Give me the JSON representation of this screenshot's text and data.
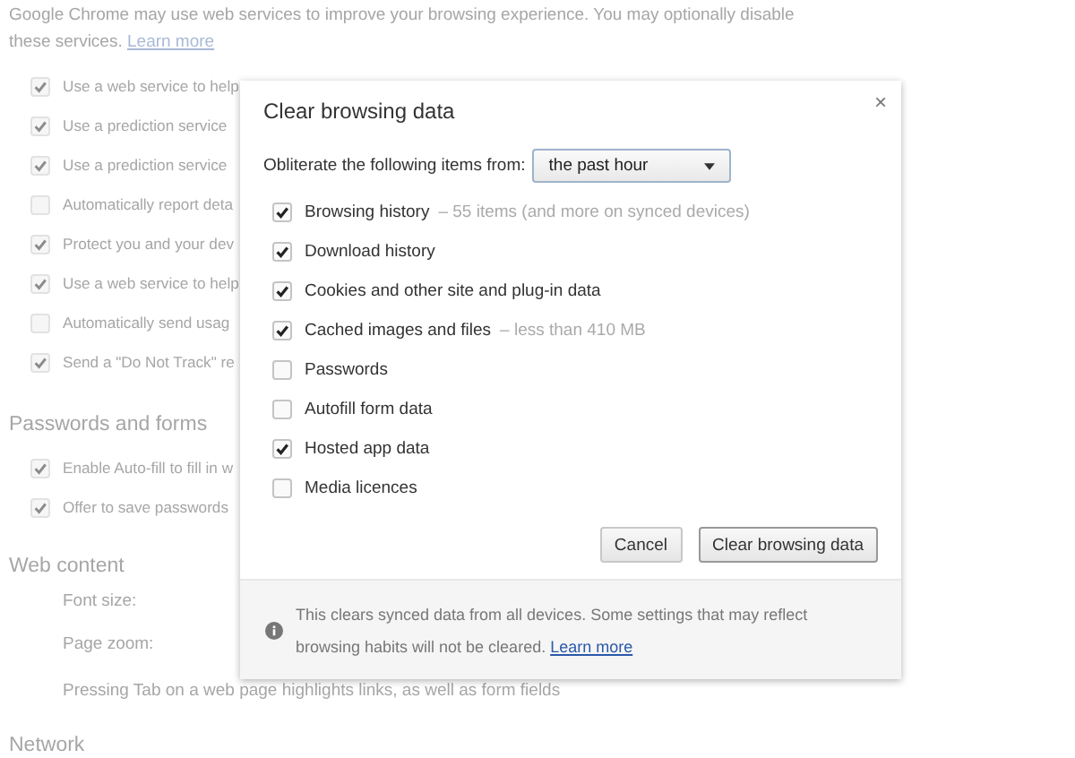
{
  "settings_page": {
    "intro": "Google Chrome may use web services to improve your browsing experience. You may optionally disable these services.",
    "intro_link": "Learn more",
    "privacy_options": [
      {
        "label": "Use a web service to help",
        "checked": true
      },
      {
        "label": "Use a prediction service",
        "checked": true
      },
      {
        "label": "Use a prediction service",
        "checked": true
      },
      {
        "label": "Automatically report deta",
        "checked": false
      },
      {
        "label": "Protect you and your dev",
        "checked": true
      },
      {
        "label": "Use a web service to help",
        "checked": true
      },
      {
        "label": "Automatically send usag",
        "checked": false
      },
      {
        "label": "Send a \"Do Not Track\" re",
        "checked": true
      }
    ],
    "passwords_heading": "Passwords and forms",
    "password_options": [
      {
        "label": "Enable Auto-fill to fill in w",
        "checked": true
      },
      {
        "label": "Offer to save passwords",
        "checked": true
      }
    ],
    "web_content_heading": "Web content",
    "web_content_rows": [
      "Font size:",
      "Page zoom:",
      "Pressing Tab on a web page highlights links, as well as form fields"
    ],
    "network_heading": "Network"
  },
  "dialog": {
    "title": "Clear browsing data",
    "close": "×",
    "range_label": "Obliterate the following items from:",
    "range_value": "the past hour",
    "items": [
      {
        "label": "Browsing history",
        "detail": "– 55 items (and more on synced devices)",
        "checked": true
      },
      {
        "label": "Download history",
        "checked": true
      },
      {
        "label": "Cookies and other site and plug-in data",
        "checked": true
      },
      {
        "label": "Cached images and files",
        "detail": "– less than 410 MB",
        "checked": true
      },
      {
        "label": "Passwords",
        "checked": false
      },
      {
        "label": "Autofill form data",
        "checked": false
      },
      {
        "label": "Hosted app data",
        "checked": true
      },
      {
        "label": "Media licences",
        "checked": false
      }
    ],
    "buttons": [
      {
        "label": "Cancel",
        "kind": "secondary"
      },
      {
        "label": "Clear browsing data",
        "kind": "primary"
      }
    ],
    "footer": {
      "text": "This clears synced data from all devices. Some settings that may reflect browsing habits will not be cleared.",
      "link": "Learn more"
    }
  }
}
